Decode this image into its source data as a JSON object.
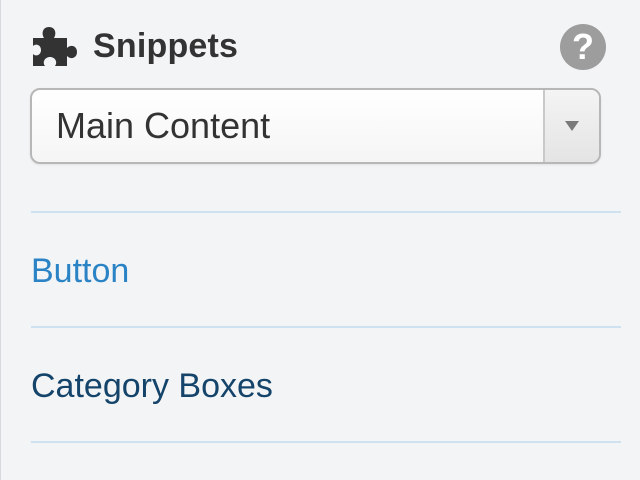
{
  "header": {
    "title": "Snippets",
    "icon": "puzzle-piece-icon",
    "help_icon": "question-circle-icon",
    "help_symbol": "?"
  },
  "select": {
    "value": "Main Content",
    "arrow_icon": "triangle-down-icon"
  },
  "snippets": [
    {
      "label": "Button"
    },
    {
      "label": "Category Boxes"
    }
  ],
  "colors": {
    "link_primary": "#2a83c5",
    "link_dark": "#15446b",
    "divider": "#cfe0ee",
    "title": "#333333",
    "help": "#9d9d9d"
  }
}
